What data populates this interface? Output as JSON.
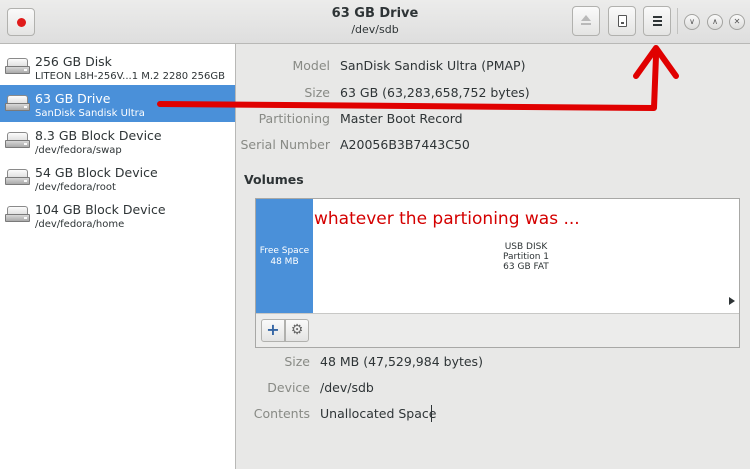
{
  "window": {
    "title": "63 GB Drive",
    "subtitle": "/dev/sdb"
  },
  "sidebar": {
    "items": [
      {
        "name": "256 GB Disk",
        "sub": "LITEON L8H-256V...1 M.2 2280 256GB",
        "selected": false
      },
      {
        "name": "63 GB Drive",
        "sub": "SanDisk Sandisk Ultra",
        "selected": true
      },
      {
        "name": "8.3 GB Block Device",
        "sub": "/dev/fedora/swap",
        "selected": false
      },
      {
        "name": "54 GB Block Device",
        "sub": "/dev/fedora/root",
        "selected": false
      },
      {
        "name": "104 GB Block Device",
        "sub": "/dev/fedora/home",
        "selected": false
      }
    ]
  },
  "drive": {
    "model_label": "Model",
    "model": "SanDisk Sandisk Ultra (PMAP)",
    "size_label": "Size",
    "size": "63 GB (63,283,658,752 bytes)",
    "partitioning_label": "Partitioning",
    "partitioning": "Master Boot Record",
    "serial_label": "Serial Number",
    "serial": "A20056B3B7443C50"
  },
  "volumes": {
    "heading": "Volumes",
    "free": {
      "line1": "Free Space",
      "line2": "48 MB"
    },
    "partition": {
      "line1": "USB DISK",
      "line2": "Partition 1",
      "line3": "63 GB FAT"
    },
    "add_symbol": "+",
    "gear_symbol": "⚙"
  },
  "selected_volume": {
    "size_label": "Size",
    "size": "48 MB (47,529,984 bytes)",
    "device_label": "Device",
    "device": "/dev/sdb",
    "contents_label": "Contents",
    "contents": "Unallocated Space"
  },
  "annotation": {
    "text": "whatever the partioning was ...",
    "color": "#d40000"
  },
  "colors": {
    "accent": "#4a90d9",
    "record": "#e01b1b"
  },
  "icons": {
    "record": "record-icon",
    "eject": "eject-icon",
    "disk": "disk-image-icon",
    "menu": "hamburger-menu-icon",
    "minimize": "chevron-down-icon",
    "maximize": "chevron-up-icon",
    "close": "close-icon",
    "drive": "harddisk-icon"
  },
  "window_controls": {
    "minimize_glyph": "∨",
    "maximize_glyph": "∧",
    "close_glyph": "✕"
  }
}
